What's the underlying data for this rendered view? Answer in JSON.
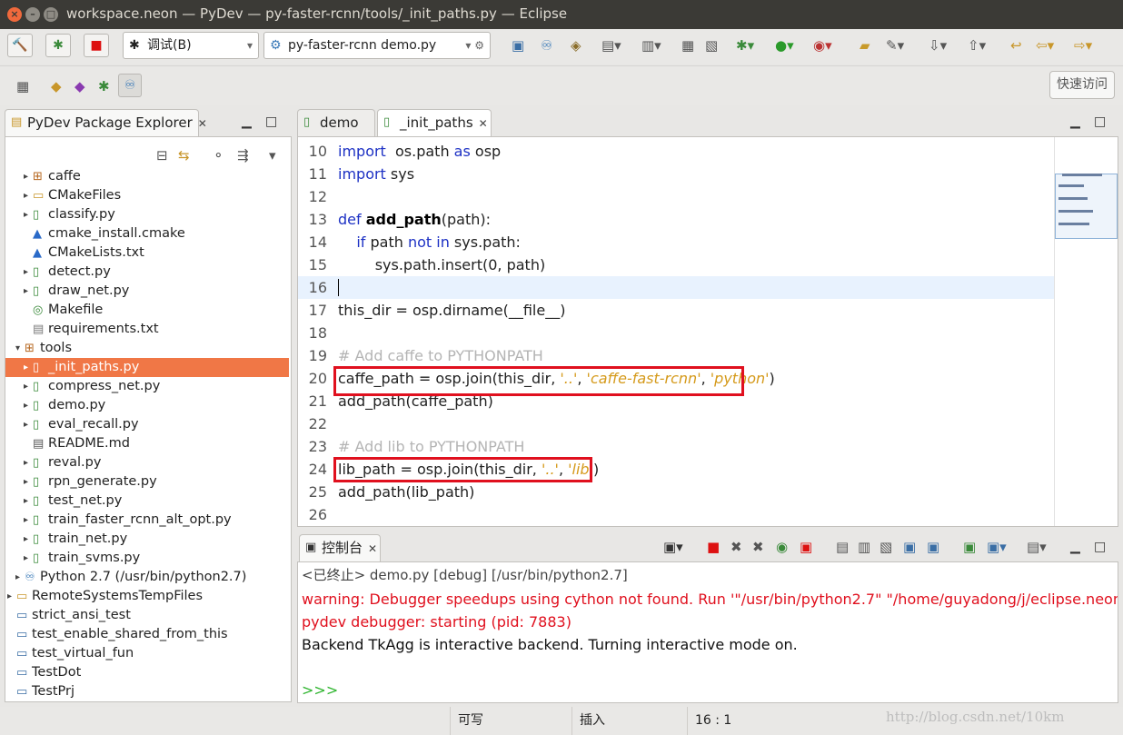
{
  "window": {
    "title": "workspace.neon — PyDev — py-faster-rcnn/tools/_init_paths.py — Eclipse"
  },
  "toolbar": {
    "debug_combo": "调试(B)",
    "launch_combo": "py-faster-rcnn demo.py",
    "quick_access": "快速访问"
  },
  "explorer": {
    "tab_label": "PyDev Package Explorer",
    "items": [
      {
        "label": "caffe",
        "icon": "package-icon",
        "arrow": "▸",
        "depth": 1
      },
      {
        "label": "CMakeFiles",
        "icon": "folder-icon",
        "arrow": "▸",
        "depth": 1
      },
      {
        "label": "classify.py",
        "icon": "py-file-icon",
        "arrow": "▸",
        "depth": 1
      },
      {
        "label": "cmake_install.cmake",
        "icon": "cmake-icon",
        "arrow": "",
        "depth": 1
      },
      {
        "label": "CMakeLists.txt",
        "icon": "cmake-icon",
        "arrow": "",
        "depth": 1
      },
      {
        "label": "detect.py",
        "icon": "py-file-icon",
        "arrow": "▸",
        "depth": 1
      },
      {
        "label": "draw_net.py",
        "icon": "py-file-icon",
        "arrow": "▸",
        "depth": 1
      },
      {
        "label": "Makefile",
        "icon": "makefile-icon",
        "arrow": "",
        "depth": 1
      },
      {
        "label": "requirements.txt",
        "icon": "text-file-icon",
        "arrow": "",
        "depth": 1
      },
      {
        "label": "tools",
        "icon": "package-icon",
        "arrow": "▾",
        "depth": 0
      },
      {
        "label": "_init_paths.py",
        "icon": "py-file-icon",
        "arrow": "▸",
        "depth": 1,
        "selected": true
      },
      {
        "label": "compress_net.py",
        "icon": "py-file-icon",
        "arrow": "▸",
        "depth": 1
      },
      {
        "label": "demo.py",
        "icon": "py-file-icon",
        "arrow": "▸",
        "depth": 1
      },
      {
        "label": "eval_recall.py",
        "icon": "py-file-icon",
        "arrow": "▸",
        "depth": 1
      },
      {
        "label": "README.md",
        "icon": "md-file-icon",
        "arrow": "",
        "depth": 1
      },
      {
        "label": "reval.py",
        "icon": "py-file-icon",
        "arrow": "▸",
        "depth": 1
      },
      {
        "label": "rpn_generate.py",
        "icon": "py-file-icon",
        "arrow": "▸",
        "depth": 1
      },
      {
        "label": "test_net.py",
        "icon": "py-file-icon",
        "arrow": "▸",
        "depth": 1
      },
      {
        "label": "train_faster_rcnn_alt_opt.py",
        "icon": "py-file-icon",
        "arrow": "▸",
        "depth": 1
      },
      {
        "label": "train_net.py",
        "icon": "py-file-icon",
        "arrow": "▸",
        "depth": 1
      },
      {
        "label": "train_svms.py",
        "icon": "py-file-icon",
        "arrow": "▸",
        "depth": 1
      },
      {
        "label": "Python 2.7  (/usr/bin/python2.7)",
        "icon": "python-icon",
        "arrow": "▸",
        "depth": 0
      },
      {
        "label": "RemoteSystemsTempFiles",
        "icon": "folder-icon",
        "arrow": "▸",
        "depth": -1
      },
      {
        "label": "strict_ansi_test",
        "icon": "project-icon",
        "arrow": "",
        "depth": -1
      },
      {
        "label": "test_enable_shared_from_this",
        "icon": "project-icon",
        "arrow": "",
        "depth": -1
      },
      {
        "label": "test_virtual_fun",
        "icon": "project-icon",
        "arrow": "",
        "depth": -1
      },
      {
        "label": "TestDot",
        "icon": "project-icon",
        "arrow": "",
        "depth": -1
      },
      {
        "label": "TestPrj",
        "icon": "project-icon",
        "arrow": "",
        "depth": -1
      }
    ]
  },
  "editor": {
    "tabs": [
      {
        "label": "demo"
      },
      {
        "label": "_init_paths"
      }
    ],
    "lines": [
      {
        "n": "10",
        "tokens": [
          [
            "kw",
            "import"
          ],
          [
            "",
            "  os.path "
          ],
          [
            "kw",
            "as"
          ],
          [
            "",
            " osp"
          ]
        ]
      },
      {
        "n": "11",
        "tokens": [
          [
            "kw",
            "import"
          ],
          [
            "",
            " sys"
          ]
        ]
      },
      {
        "n": "12",
        "tokens": []
      },
      {
        "n": "13",
        "tokens": [
          [
            "kw",
            "def"
          ],
          [
            "",
            " "
          ],
          [
            "fn",
            "add_path"
          ],
          [
            "",
            "(path):"
          ]
        ]
      },
      {
        "n": "14",
        "tokens": [
          [
            "",
            "    "
          ],
          [
            "kw",
            "if"
          ],
          [
            "",
            " path "
          ],
          [
            "kw",
            "not in"
          ],
          [
            "",
            " sys.path:"
          ]
        ]
      },
      {
        "n": "15",
        "tokens": [
          [
            "",
            "        sys.path.insert(0, path)"
          ]
        ]
      },
      {
        "n": "16",
        "tokens": [],
        "current": true
      },
      {
        "n": "17",
        "tokens": [
          [
            "",
            "this_dir = osp.dirname(__file__)"
          ]
        ]
      },
      {
        "n": "18",
        "tokens": []
      },
      {
        "n": "19",
        "tokens": [
          [
            "cm",
            "# Add caffe to PYTHONPATH"
          ]
        ]
      },
      {
        "n": "20",
        "tokens": [
          [
            "",
            "caffe_path = osp.join(this_dir, "
          ],
          [
            "str",
            "'..'"
          ],
          [
            "",
            ", "
          ],
          [
            "str",
            "'caffe-fast-rcnn'"
          ],
          [
            "",
            ", "
          ],
          [
            "str",
            "'python'"
          ],
          [
            "",
            ")"
          ]
        ]
      },
      {
        "n": "21",
        "tokens": [
          [
            "",
            "add_path(caffe_path)"
          ]
        ]
      },
      {
        "n": "22",
        "tokens": []
      },
      {
        "n": "23",
        "tokens": [
          [
            "cm",
            "# Add lib to PYTHONPATH"
          ]
        ]
      },
      {
        "n": "24",
        "tokens": [
          [
            "",
            "lib_path = osp.join(this_dir, "
          ],
          [
            "str",
            "'..'"
          ],
          [
            "",
            ", "
          ],
          [
            "str",
            "'lib'"
          ],
          [
            "",
            ")"
          ]
        ]
      },
      {
        "n": "25",
        "tokens": [
          [
            "",
            "add_path(lib_path)"
          ]
        ]
      },
      {
        "n": "26",
        "tokens": []
      }
    ]
  },
  "console": {
    "tab_label": "控制台",
    "header": "<已终止> demo.py [debug] [/usr/bin/python2.7]",
    "lines": [
      {
        "text": "warning: Debugger speedups using cython not found. Run '\"/usr/bin/python2.7\" \"/home/guyadong/j/eclipse.neon/dropi",
        "color": "#e0101e"
      },
      {
        "text": "pydev debugger: starting (pid: 7883)",
        "color": "#e0101e"
      },
      {
        "text": "Backend TkAgg is interactive backend. Turning interactive mode on.",
        "color": "#111111"
      },
      {
        "text": "",
        "color": "#111111"
      },
      {
        "text": ">>>",
        "color": "#2fb52f"
      }
    ]
  },
  "status": {
    "writable": "可写",
    "insert_mode": "插入",
    "position": "16 : 1"
  },
  "watermark": "http://blog.csdn.net/10km"
}
